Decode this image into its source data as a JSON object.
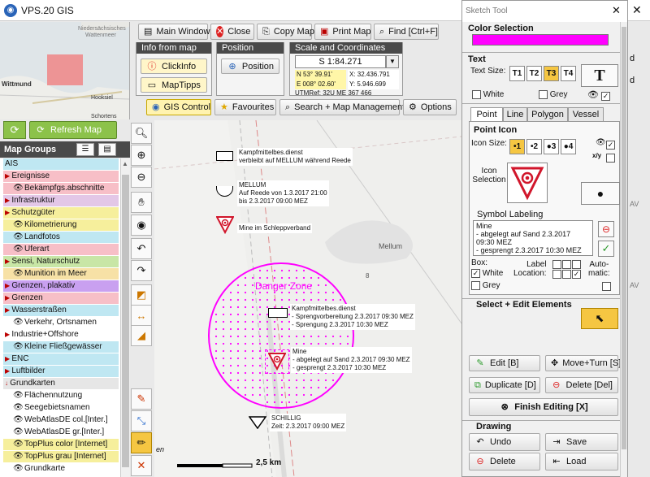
{
  "app": {
    "title": "VPS.20  GIS",
    "icon": "globe-icon"
  },
  "toolbar": {
    "main_window": "Main Window",
    "close": "Close",
    "copy_map": "Copy Map",
    "print_map": "Print Map",
    "find": "Find [Ctrl+F]"
  },
  "info": {
    "title": "Info from map",
    "click_info": "ClickInfo",
    "map_tips": "MapTipps"
  },
  "position": {
    "title": "Position",
    "button": "Position"
  },
  "scale": {
    "title": "Scale and Coordinates",
    "value": "S 1:84.271",
    "lat": "N 53° 39.91'",
    "lon": "E 008° 02.60'",
    "x": "X: 32.436.791",
    "y": "Y: 5.946.699",
    "utm": "UTMRef: 32U ME 367 466"
  },
  "tabs": {
    "gis_control": "GIS Control",
    "favourites": "Favourites",
    "search": "Search + Map Management",
    "options": "Options"
  },
  "overview": {
    "labels": [
      "Niedersächsisches",
      "Wattenmeer",
      "Wittmund",
      "Hooksiel",
      "Schortens"
    ]
  },
  "sidebar": {
    "refresh": "Refresh Map",
    "header": "Map Groups",
    "layers": [
      {
        "label": "AIS",
        "bg": "#bfe7f2",
        "indent": 0
      },
      {
        "label": "Ereignisse",
        "bg": "#f7bfc7",
        "indent": 0,
        "arrow": "▶"
      },
      {
        "label": "Bekämpfgs.abschnitte",
        "bg": "#f7bfc7",
        "indent": 1
      },
      {
        "label": "Infrastruktur",
        "bg": "#e3c7e7",
        "indent": 0,
        "arrow": "▶"
      },
      {
        "label": "Schutzgüter",
        "bg": "#f6ef9c",
        "indent": 0,
        "arrow": "▶"
      },
      {
        "label": "Kilometrierung",
        "bg": "#f6ef9c",
        "indent": 1
      },
      {
        "label": "Landfotos",
        "bg": "#bfe7f2",
        "indent": 1
      },
      {
        "label": "Uferart",
        "bg": "#f7bfc7",
        "indent": 1
      },
      {
        "label": "Sensi, Naturschutz",
        "bg": "#c8e6a6",
        "indent": 0,
        "arrow": "▶"
      },
      {
        "label": "Munition im Meer",
        "bg": "#f7e1a6",
        "indent": 1
      },
      {
        "label": "Grenzen, plakativ",
        "bg": "#c9a0f0",
        "indent": 0,
        "arrow": "▶"
      },
      {
        "label": "Grenzen",
        "bg": "#f7bfc7",
        "indent": 0,
        "arrow": "▶"
      },
      {
        "label": "Wasserstraßen",
        "bg": "#bfe7f2",
        "indent": 0,
        "arrow": "▶"
      },
      {
        "label": "Verkehr, Ortsnamen",
        "bg": "#ffffff",
        "indent": 1
      },
      {
        "label": "Industrie+Offshore",
        "bg": "#ffffff",
        "indent": 0,
        "arrow": "▶"
      },
      {
        "label": "Kleine Fließgewässer",
        "bg": "#bfe7f2",
        "indent": 1
      },
      {
        "label": "ENC",
        "bg": "#bfe7f2",
        "indent": 0,
        "arrow": "▶"
      },
      {
        "label": "Luftbilder",
        "bg": "#bfe7f2",
        "indent": 0,
        "arrow": "▶"
      },
      {
        "label": "Grundkarten",
        "bg": "#e6e6e6",
        "indent": 0,
        "arrow": "↓"
      },
      {
        "label": "Flächennutzung",
        "bg": "#ffffff",
        "indent": 1
      },
      {
        "label": "Seegebietsnamen",
        "bg": "#ffffff",
        "indent": 1
      },
      {
        "label": "WebAtlasDE col.[Inter.]",
        "bg": "#ffffff",
        "indent": 1
      },
      {
        "label": "WebAtlasDE gr.[Inter.]",
        "bg": "#ffffff",
        "indent": 1
      },
      {
        "label": "TopPlus color [Internet]",
        "bg": "#f6ef9c",
        "indent": 1
      },
      {
        "label": "TopPlus grau [Internet]",
        "bg": "#f6ef9c",
        "indent": 1
      },
      {
        "label": "Grundkarte",
        "bg": "#ffffff",
        "indent": 1
      }
    ]
  },
  "map": {
    "danger_zone": "Danger Zone",
    "mellum_place": "Mellum",
    "depth": "8",
    "scale_bar": "2,5 km",
    "edge_text": "en",
    "labels": {
      "kampf1": "Kampfmittelbes.dienst\nverbleibt auf MELLUM während Reede",
      "mellum": "MELLUM\nAuf Reede von 1.3.2017 21:00\nbis 2.3.2017 09:00 MEZ",
      "mine1": "Mine im Schleppverband",
      "kampf2": "Kampfmittelbes.dienst\n- Sprengvorbereitung 2.3.2017 09:30 MEZ\n- Sprengung 2.3.2017 10:30 MEZ",
      "mine2": "Mine\n- abgelegt auf Sand 2.3.2017 09:30 MEZ\n- gesprengt 2.3.2017 10:30 MEZ",
      "schillig": "SCHILLIG\nZeit: 2.3.2017 09:00 MEZ"
    }
  },
  "sketch": {
    "title": "Sketch Tool",
    "color_selection": "Color Selection",
    "color": "#ff00ff",
    "text": "Text",
    "text_size": "Text Size:",
    "sizes": [
      "T1",
      "T2",
      "T3",
      "T4"
    ],
    "white": "White",
    "grey": "Grey",
    "geom_tabs": [
      "Point",
      "Line",
      "Polygon",
      "Vessel"
    ],
    "point_icon": "Point Icon",
    "icon_size": "Icon Size:",
    "icon_sizes": [
      "•1",
      "•2",
      "●3",
      "●4"
    ],
    "xy": "x/y",
    "icon_selection": "Icon\nSelection",
    "symbol_labeling": "Symbol Labeling",
    "label_text": "Mine\n- abgelegt auf Sand 2.3.2017\n09:30 MEZ\n- gesprengt 2.3.2017 10:30 MEZ",
    "box": "Box:",
    "label_location": "Label\nLocation:",
    "automatic": "Auto-\nmatic:",
    "select_edit": "Select + Edit Elements",
    "edit": "Edit [B]",
    "move_turn": "Move+Turn [S]",
    "duplicate": "Duplicate [D]",
    "delete_del": "Delete [Del]",
    "finish": "Finish Editing [X]",
    "drawing": "Drawing",
    "undo": "Undo",
    "save": "Save",
    "delete": "Delete",
    "load": "Load"
  },
  "right_edge": {
    "letters": [
      "d",
      "d",
      "AV",
      "AV"
    ]
  }
}
